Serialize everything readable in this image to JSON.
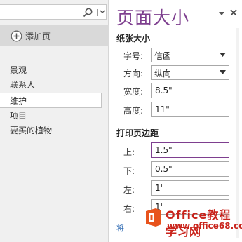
{
  "navigation": {
    "search": {
      "value": "",
      "placeholder": ""
    },
    "add_page_label": "添加页",
    "pages": [
      {
        "label": "景观",
        "selected": false
      },
      {
        "label": "联系人",
        "selected": false
      },
      {
        "label": "维护",
        "selected": true
      },
      {
        "label": "项目",
        "selected": false
      },
      {
        "label": "要买的植物",
        "selected": false
      }
    ]
  },
  "pane": {
    "title": "页面大小",
    "paper_size": {
      "section_title": "纸张大小",
      "fields": [
        {
          "label": "字号:",
          "value": "信函",
          "type": "select"
        },
        {
          "label": "方向:",
          "value": "纵向",
          "type": "select"
        },
        {
          "label": "宽度:",
          "value": "8.5\"",
          "type": "text"
        },
        {
          "label": "高度:",
          "value": "11\"",
          "type": "text"
        }
      ]
    },
    "margins": {
      "section_title": "打印页边距",
      "fields": [
        {
          "label": "上:",
          "value": "1.5\""
        },
        {
          "label": "下:",
          "value": "0.5\""
        },
        {
          "label": "左:",
          "value": "1\""
        },
        {
          "label": "右:",
          "value": "1\""
        }
      ]
    },
    "footer_link_text": "将"
  },
  "watermark": {
    "brand_text": "Office教程学习网",
    "url": "www.office68.com"
  },
  "colors": {
    "accent": "#7e3f8f",
    "watermark": "#c9231b",
    "logo_orange": "#e8531c",
    "link": "#2e6ab3"
  }
}
